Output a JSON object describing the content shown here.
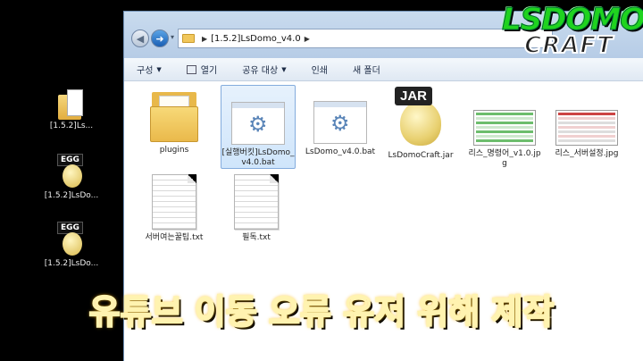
{
  "desktop": {
    "icons": [
      {
        "label": "[1.5.2]Ls..."
      },
      {
        "label": "[1.5.2]LsDo..."
      },
      {
        "label": "[1.5.2]LsDo..."
      }
    ],
    "egg_tag": "EGG"
  },
  "explorer": {
    "address": {
      "path": "[1.5.2]LsDomo_v4.0"
    },
    "toolbar": {
      "organize": "구성",
      "open": "열기",
      "share": "공유 대상",
      "print": "인쇄",
      "new_folder": "새 폴더"
    },
    "files": [
      {
        "name": "plugins",
        "type": "folder"
      },
      {
        "name": "[실행버킷]LsDomo_v4.0.bat",
        "type": "bat",
        "selected": true
      },
      {
        "name": "LsDomo_v4.0.bat",
        "type": "bat"
      },
      {
        "name": "LsDomoCraft.jar",
        "type": "jar"
      },
      {
        "name": "리스_명령어_v1.0.jpg",
        "type": "jpg"
      },
      {
        "name": "리스_서버설정.jpg",
        "type": "jpg"
      },
      {
        "name": "서버여는꿀팁.txt",
        "type": "txt"
      },
      {
        "name": "필독.txt",
        "type": "txt"
      }
    ],
    "jar_tag": "JAR"
  },
  "logo": {
    "line1": "LSDOMO",
    "line2": "CRAFT"
  },
  "caption": "유튜브 이동 오류 유저 위해 제작",
  "colors": {
    "caption": "#ff2a2a",
    "logo_green": "#1fd31f",
    "selection": "#cfe5fb"
  }
}
